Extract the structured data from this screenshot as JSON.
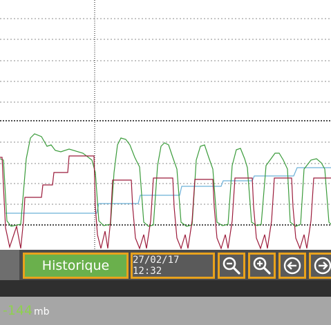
{
  "toolbar": {
    "historique_label": "Historique",
    "date_value": "27/02/17 12:32",
    "buttons": [
      {
        "name": "zoom-out",
        "icon": "zoom-out-icon"
      },
      {
        "name": "zoom-in",
        "icon": "zoom-in-icon"
      },
      {
        "name": "previous",
        "icon": "arrow-left-circle-icon"
      },
      {
        "name": "next",
        "icon": "arrow-right-circle-icon"
      }
    ]
  },
  "status": {
    "pressure_value": "-144",
    "pressure_unit": "mb"
  },
  "colors": {
    "accent_border": "#e9a21c",
    "historique_bg": "#6ab04c",
    "trace_green": "#3a9b3a",
    "trace_red": "#9b1a3a",
    "trace_blue": "#6ab0d8",
    "value_green": "#8fd14f"
  }
}
